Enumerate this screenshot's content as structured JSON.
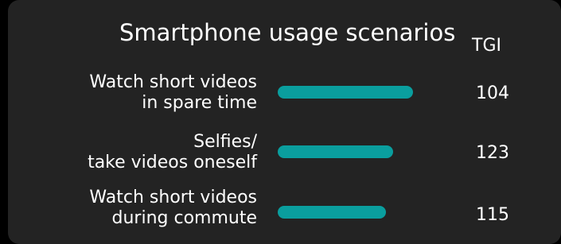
{
  "chart_data": {
    "type": "bar",
    "orientation": "horizontal",
    "title": "Smartphone usage scenarios",
    "value_header": "TGI",
    "categories": [
      [
        "Watch short videos",
        "in spare time"
      ],
      [
        "Selfies/",
        "take videos oneself"
      ],
      [
        "Watch short videos",
        "during commute"
      ]
    ],
    "values": [
      104,
      123,
      115
    ],
    "bar_fill_fraction": [
      1.0,
      0.85,
      0.8
    ],
    "bar_color": "#0a9e9e",
    "background_color": "#232323",
    "grid": false,
    "legend": "none"
  }
}
